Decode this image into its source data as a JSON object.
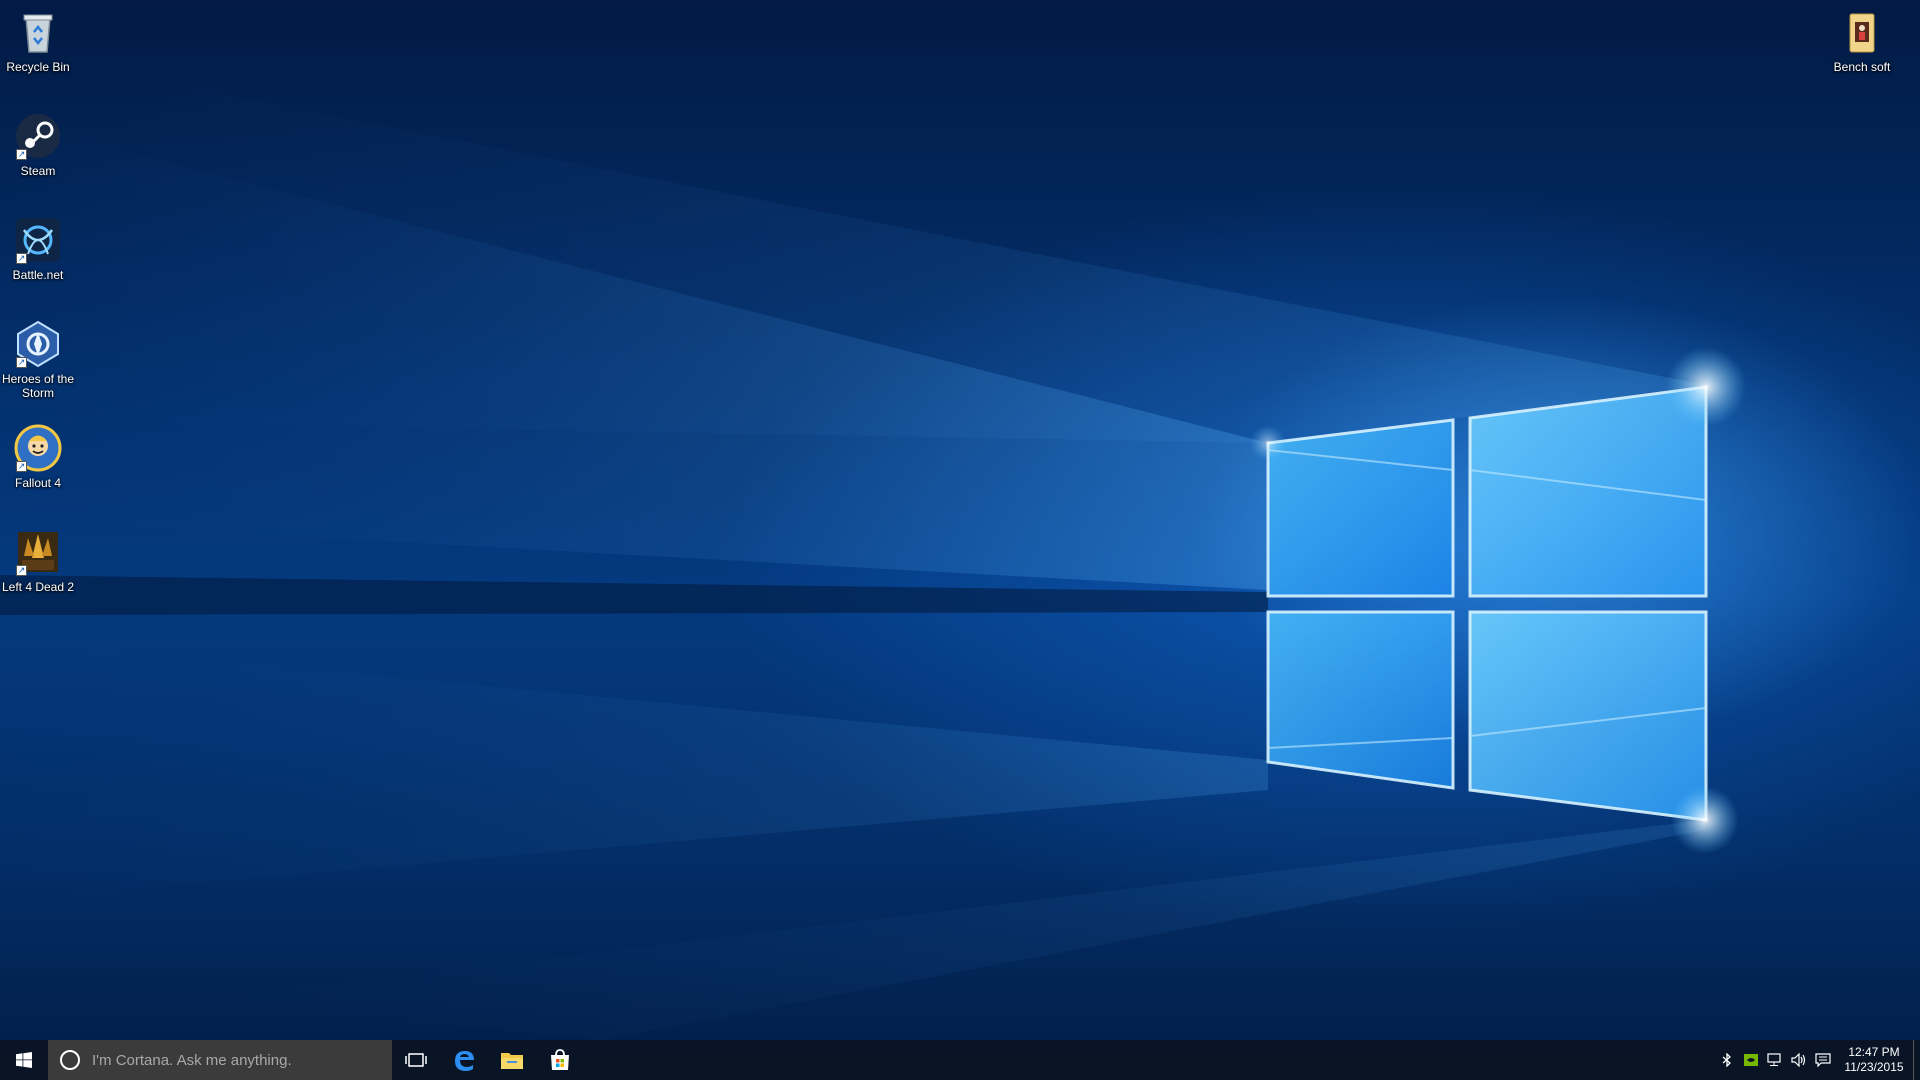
{
  "desktop": {
    "icons": [
      {
        "label": "Recycle Bin",
        "icon": "recycle-bin-icon"
      },
      {
        "label": "Steam",
        "icon": "steam-icon"
      },
      {
        "label": "Battle.net",
        "icon": "battlenet-icon"
      },
      {
        "label": "Heroes of the Storm",
        "icon": "heroes-of-the-storm-icon"
      },
      {
        "label": "Fallout 4",
        "icon": "fallout-4-icon"
      },
      {
        "label": "Left 4 Dead 2",
        "icon": "left-4-dead-2-icon"
      },
      {
        "label": "Bench soft",
        "icon": "folder-icon"
      }
    ]
  },
  "taskbar": {
    "search_placeholder": "I'm Cortana. Ask me anything.",
    "pinned": [
      "task-view-icon",
      "edge-icon",
      "file-explorer-icon",
      "store-icon"
    ],
    "tray": [
      "bluetooth-icon",
      "nvidia-icon",
      "network-icon",
      "volume-icon",
      "action-center-icon"
    ],
    "time": "12:47 PM",
    "date": "11/23/2015"
  },
  "colors": {
    "accent": "#1e90ff",
    "taskbar": "#0a1423",
    "search": "#3b3b3b"
  }
}
